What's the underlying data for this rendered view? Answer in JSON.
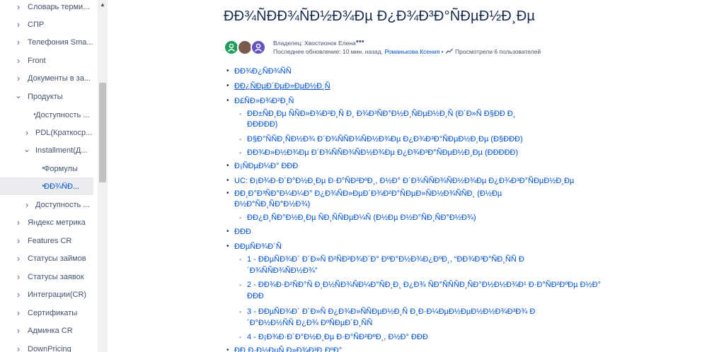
{
  "sidebar": {
    "items": [
      {
        "label": "Словарь терми...",
        "kind": "chevron-right"
      },
      {
        "label": "СПР",
        "kind": "chevron-right"
      },
      {
        "label": "Телефония Sma...",
        "kind": "chevron-right"
      },
      {
        "label": "Front",
        "kind": "chevron-right"
      },
      {
        "label": "Документы в за...",
        "kind": "chevron-right"
      },
      {
        "label": "Продукты",
        "kind": "chevron-down"
      },
      {
        "label": "Доступность ...",
        "kind": "dot"
      },
      {
        "label": "PDL(Краткоср...",
        "kind": "chevron-right"
      },
      {
        "label": "Installment(Д...",
        "kind": "chevron-down"
      },
      {
        "label": "Формулы",
        "kind": "dot"
      },
      {
        "label": "ÐÐ¾ÑÐ...",
        "kind": "dot"
      },
      {
        "label": "Доступность ...",
        "kind": "chevron-right"
      },
      {
        "label": "Яндекс метрика",
        "kind": "chevron-right"
      },
      {
        "label": "Features CR",
        "kind": "chevron-right"
      },
      {
        "label": "Статусы займов",
        "kind": "chevron-right"
      },
      {
        "label": "Статусы заявок",
        "kind": "chevron-right"
      },
      {
        "label": "Интеграции(CR)",
        "kind": "chevron-right"
      },
      {
        "label": "Сертификаты",
        "kind": "chevron-right"
      },
      {
        "label": "Админка CR",
        "kind": "chevron-right"
      },
      {
        "label": "DownPricing",
        "kind": "chevron-right"
      }
    ]
  },
  "page": {
    "title": "ÐÐ¾ÑÐÐ¾ÑÐ½Ð¾Ðµ Ð¿Ð¾Ð³Ð°ÑÐµÐ½Ð¸Ðµ",
    "owner": "Владелец: Хвостионок Елена",
    "owner_more": "•••",
    "updated_prefix": "Последнее обновление: 10 мин. назад.",
    "updated_editor": "Романькова Ксения",
    "updated_sep": "•",
    "views": "Просмотрели 6 пользователей"
  },
  "content": {
    "items": [
      {
        "text": "ÐÐ¾Ð¿ÑÐ¾ÑÑ",
        "level": 0
      },
      {
        "text": "ÐÐ¿ÑÐµÐ´ÐµÐ»ÐµÐ½Ð¸Ñ",
        "level": 0,
        "underline": true
      },
      {
        "text": "Ð£ÑÐ»Ð¾Ð²Ð¸Ñ",
        "level": 0
      },
      {
        "text": "ÐÐ±ÑÐ¸Ðµ ÑÑÐ»Ð¾Ð²Ð¸Ñ Ð¸ Ð¾Ð³ÑÐ°Ð½Ð¸ÑÐµÐ½Ð¸Ñ (Ð´Ð»Ñ Ð§ÐÐ Ð¸",
        "level": 1
      },
      {
        "text": "ÐÐÐÐÐ)",
        "level": 1,
        "cont": true
      },
      {
        "text": "Ð§Ð°ÑÑÐ¸ÑÐ½Ð¾ Ð´Ð¾ÑÑÐ¾ÑÐ½Ð¾Ðµ Ð¿Ð¾Ð³Ð°ÑÐµÐ½Ð¸Ðµ (Ð§ÐÐÐ)",
        "level": 1
      },
      {
        "text": "ÐÐ¾Ð»Ð½Ð¾Ðµ Ð´Ð¾ÑÑÐ¾ÑÐ½Ð¾Ðµ Ð¿Ð¾Ð³Ð°ÑÐµÐ½Ð¸Ðµ (ÐÐÐÐÐ)",
        "level": 1
      },
      {
        "text": "Ð¡ÑÐµÐ¼Ð° ÐÐÐ",
        "level": 0
      },
      {
        "text": "UC: Ð¡Ð¾Ð·Ð´Ð°Ð½Ð¸Ðµ Ð·Ð°ÑÐ²ÐºÐ¸, Ð½Ð° Ð´Ð¾ÑÑÐ¾ÑÐ½Ð¾Ðµ Ð¿Ð¾Ð³Ð°ÑÐµÐ½Ð¸Ðµ",
        "level": 0
      },
      {
        "text": "ÐÐ¸Ð°Ð³ÑÐ°Ð¼Ð¼Ð° Ð¿Ð¾ÑÐ»ÐµÐ´Ð¾Ð²Ð°ÑÐµÐ»ÑÐ½Ð¾ÑÑÐ¸ (Ð½Ðµ",
        "level": 0
      },
      {
        "text": "Ð½Ð°ÑÐ¸ÑÐ°Ð½Ð¾)",
        "level": 0,
        "cont": true
      },
      {
        "text": "ÐÐ¿Ð¸ÑÐ°Ð½Ð¸Ðµ ÑÐ¸ÑÑÐµÐ¼Ñ (Ð½Ðµ Ð½Ð°ÑÐ¸ÑÐ°Ð½Ð¾)",
        "level": 1
      },
      {
        "text": "ÐÐÐ",
        "level": 0
      },
      {
        "text": "ÐÐµÑÐ¾Ð´Ñ",
        "level": 0
      },
      {
        "text": "1 - ÐÐµÑÐ¾Ð´ Ð´Ð»Ñ Ð²ÑÐ²Ð¾Ð´Ð° ÐºÐ°Ð½Ð¾Ð¿ÐºÐ¸, “ÐÐ¾Ð³Ð°ÑÐ¸ÑÑ Ð",
        "level": 1
      },
      {
        "text": "´Ð¾ÑÑÐ¾ÑÐ½Ð¾”",
        "level": 1,
        "cont": true
      },
      {
        "text": "2 - ÐÐ¾Ð·Ð²ÑÐ°Ñ Ð¸Ð½ÑÐ¾ÑÐ¼Ð°ÑÐ¸Ð¸ Ð¿Ð¾ ÑÐ°ÑÑÑÐ¸ÑÐ°Ð½Ð½Ð¾Ð¹ Ð·Ð°ÑÐ²ÐºÐµ Ð½Ð°",
        "level": 1
      },
      {
        "text": "ÐÐÐ",
        "level": 1,
        "cont": true
      },
      {
        "text": "3 - ÐÐµÑÐ¾Ð´ Ð´Ð»Ñ Ð¿Ð¾Ð»ÑÑÐµÐ½Ð¸Ñ Ð¸Ð·Ð¼ÐµÐ½ÐµÐ½Ð½Ð¾Ð³Ð¾ Ð",
        "level": 1
      },
      {
        "text": "´Ð°Ð½Ð½ÑÑ Ð¿Ð¾ ÐºÑÐµÐ´Ð¸ÑÑ",
        "level": 1,
        "cont": true
      },
      {
        "text": "4 - Ð¡Ð¾Ð·Ð´Ð°Ð½Ð¸Ðµ Ð·Ð°ÑÐ²ÐºÐ¸, Ð½Ð° ÐÐÐ",
        "level": 1
      },
      {
        "text": "ÐÐ¸Ð·Ð½ÐµÑ Ð»Ð¾Ð³Ð¸ÐºÐ°",
        "level": 0
      }
    ]
  },
  "colors": {
    "link": "#0052cc",
    "text": "#172b4d",
    "muted": "#42526e",
    "active_bg": "#ebecf0"
  }
}
